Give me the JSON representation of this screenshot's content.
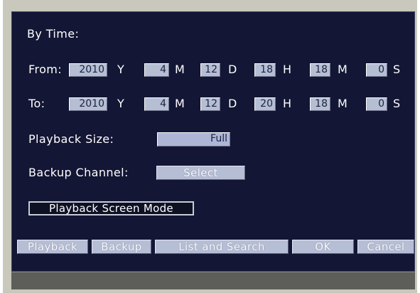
{
  "section_title": "By Time:",
  "from": {
    "label": "From:",
    "year": "2010",
    "year_unit": "Y",
    "month": "4",
    "month_unit": "M",
    "day": "12",
    "day_unit": "D",
    "hour": "18",
    "hour_unit": "H",
    "minute": "18",
    "minute_unit": "M",
    "second": "0",
    "second_unit": "S"
  },
  "to": {
    "label": "To:",
    "year": "2010",
    "year_unit": "Y",
    "month": "4",
    "month_unit": "M",
    "day": "12",
    "day_unit": "D",
    "hour": "20",
    "hour_unit": "H",
    "minute": "18",
    "minute_unit": "M",
    "second": "0",
    "second_unit": "S"
  },
  "playback_size": {
    "label": "Playback Size:",
    "value": "Full"
  },
  "backup_channel": {
    "label": "Backup Channel:",
    "button": "Select"
  },
  "playback_screen_mode": "Playback Screen Mode",
  "buttons": {
    "playback": "Playback",
    "backup": "Backup",
    "list_search": "List and Search",
    "ok": "OK",
    "cancel": "Cancel"
  },
  "colors": {
    "panel_bg": "#131634",
    "field_bg": "#b6bed4",
    "frame": "#c8c8bc",
    "status_bar": "#5d5d59"
  }
}
